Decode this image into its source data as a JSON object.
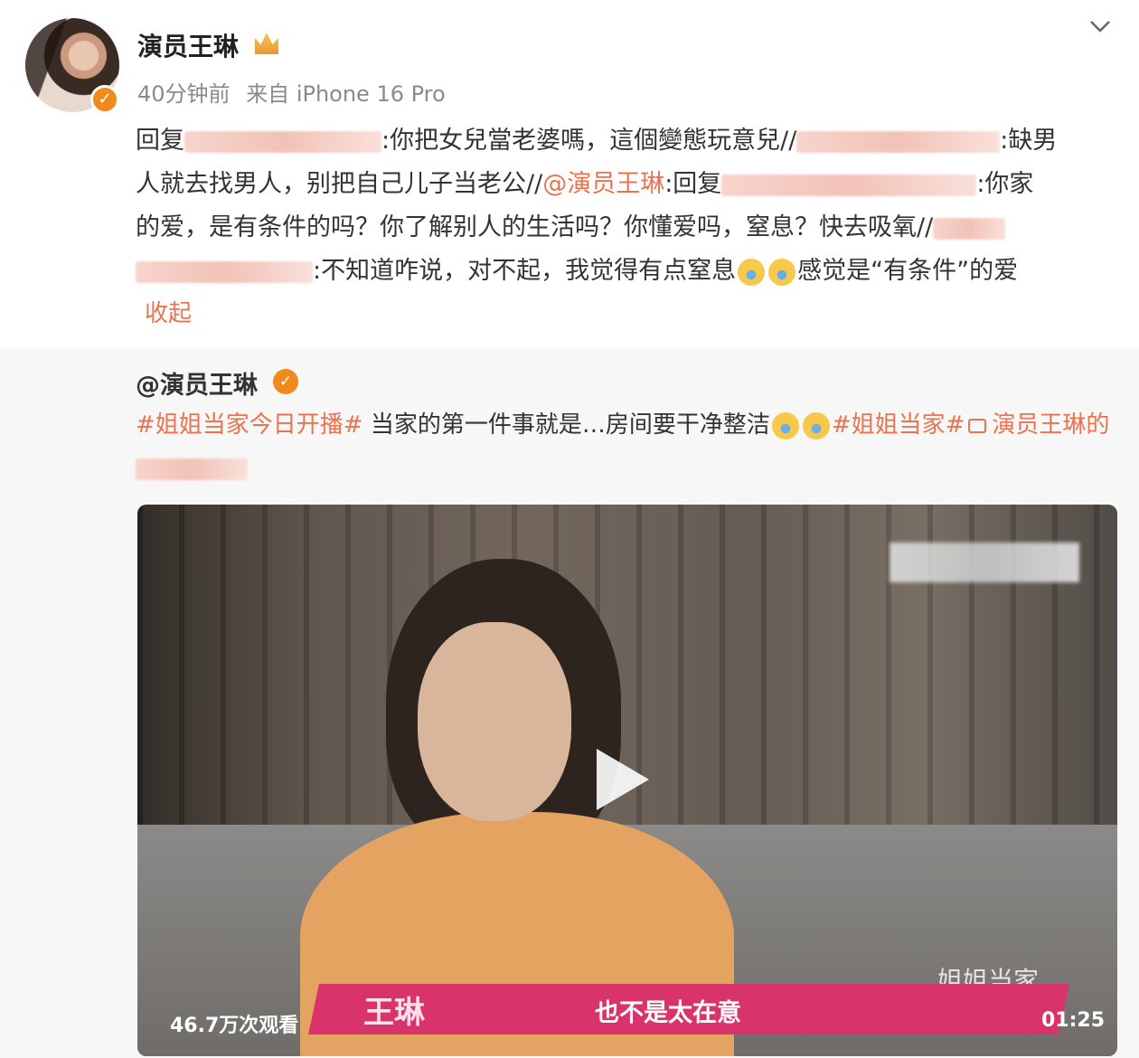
{
  "post": {
    "author": "演员王琳",
    "time": "40分钟前",
    "source": "来自 iPhone 16 Pro",
    "text": {
      "p1": "回复",
      "p2": ":你把女兒當老婆嗎，這個變態玩意兒//",
      "p3": ":缺男",
      "p4": "人就去找男人，别把自己儿子当老公//",
      "p5": "@演员王琳",
      "p6": ":回复",
      "p7": ":你家",
      "p8": "的爱，是有条件的吗？你了解别人的生活吗？你懂爱吗，窒息？快去吸氧//",
      "p9": ":不知道咋说，对不起，我觉得有点窒息",
      "p10": "感觉是“有条件”的爱"
    },
    "collapse_label": "收起"
  },
  "repost": {
    "author": "@演员王琳",
    "topic1": "#姐姐当家今日开播#",
    "text1": " 当家的第一件事就是…房间要干净整洁",
    "topic2": "#姐姐当家#",
    "video_link": "演员王琳的",
    "video": {
      "views": "46.7万次观看",
      "duration": "01:25",
      "subtitle_name": "王琳",
      "subtitle_text": "也不是太在意",
      "show_logo": "姐姐当家"
    }
  },
  "colors": {
    "accent": "#eb7350",
    "verified": "#f08a1a",
    "subtitle_bar": "#d8336a"
  },
  "icons": [
    "crown-icon",
    "chevron-down-icon",
    "verified-icon",
    "emoji-icon",
    "video-link-icon",
    "play-icon"
  ]
}
